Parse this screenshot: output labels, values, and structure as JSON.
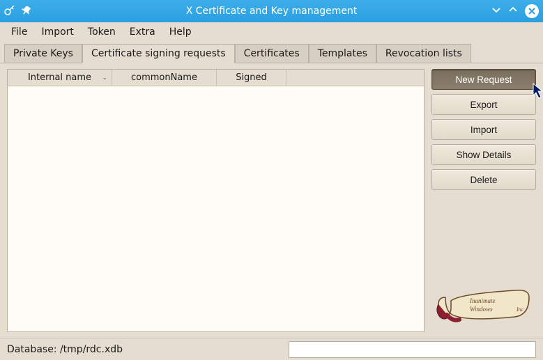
{
  "window": {
    "title": "X Certificate and Key management"
  },
  "menu": {
    "items": [
      "File",
      "Import",
      "Token",
      "Extra",
      "Help"
    ]
  },
  "tabs": {
    "items": [
      {
        "label": "Private Keys",
        "active": false
      },
      {
        "label": "Certificate signing requests",
        "active": true
      },
      {
        "label": "Certificates",
        "active": false
      },
      {
        "label": "Templates",
        "active": false
      },
      {
        "label": "Revocation lists",
        "active": false
      }
    ]
  },
  "table": {
    "columns": [
      {
        "label": "Internal name",
        "sortable": true
      },
      {
        "label": "commonName",
        "sortable": false
      },
      {
        "label": "Signed",
        "sortable": false
      }
    ]
  },
  "actions": {
    "new_request": "New Request",
    "export": "Export",
    "import": "Import",
    "show_details": "Show Details",
    "delete": "Delete"
  },
  "status": {
    "database_label": "Database: /tmp/rdc.xdb",
    "search_value": ""
  }
}
